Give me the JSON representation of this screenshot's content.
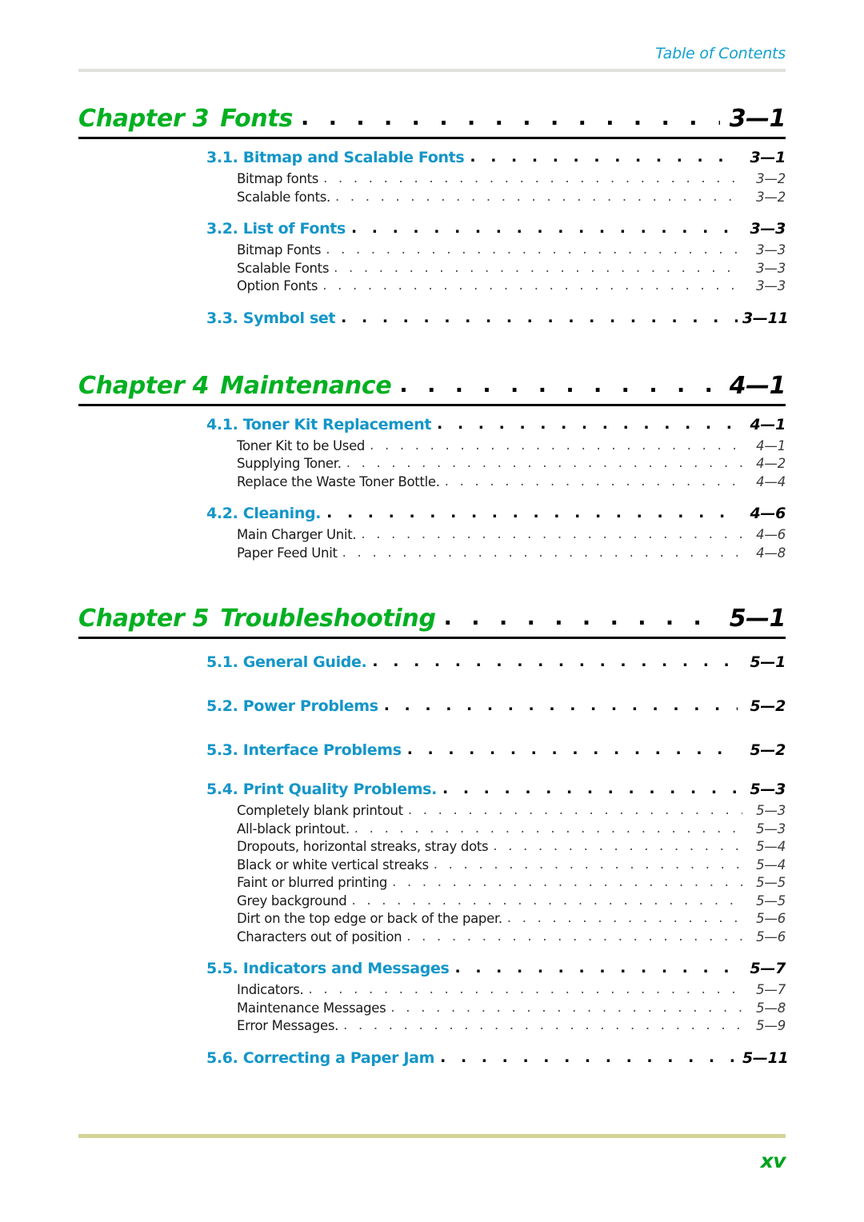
{
  "header": {
    "title": "Table of Contents",
    "rule_color": "#e2e0dc"
  },
  "colors": {
    "chapter_green": "#00b021",
    "section_teal": "#1496c8",
    "subentry_black": "#1a1a1a",
    "footer_rule": "#d4d296",
    "footer_green": "#00a21e"
  },
  "chapters": [
    {
      "label": "Chapter 3",
      "name": "Fonts",
      "page": "3—1",
      "sections": [
        {
          "title": "3.1. Bitmap and Scalable Fonts",
          "page": "3—1",
          "subs": [
            {
              "title": "Bitmap fonts",
              "page": "3—2"
            },
            {
              "title": "Scalable fonts.",
              "page": "3—2"
            }
          ]
        },
        {
          "title": "3.2. List of Fonts",
          "page": "3—3",
          "subs": [
            {
              "title": "Bitmap Fonts",
              "page": "3—3"
            },
            {
              "title": "Scalable Fonts",
              "page": "3—3"
            },
            {
              "title": "Option Fonts",
              "page": "3—3"
            }
          ]
        },
        {
          "title": "3.3. Symbol set",
          "page": "3—11",
          "subs": []
        }
      ]
    },
    {
      "label": "Chapter 4",
      "name": "Maintenance",
      "page": "4—1",
      "sections": [
        {
          "title": "4.1. Toner Kit Replacement",
          "page": "4—1",
          "subs": [
            {
              "title": "Toner Kit to be Used",
              "page": "4—1"
            },
            {
              "title": "Supplying Toner.",
              "page": "4—2"
            },
            {
              "title": "Replace the Waste Toner Bottle.",
              "page": "4—4"
            }
          ]
        },
        {
          "title": "4.2. Cleaning.",
          "page": "4—6",
          "subs": [
            {
              "title": "Main Charger Unit.",
              "page": "4—6"
            },
            {
              "title": "Paper Feed Unit",
              "page": "4—8"
            }
          ]
        }
      ]
    },
    {
      "label": "Chapter 5",
      "name": "Troubleshooting",
      "page": "5—1",
      "sections": [
        {
          "title": "5.1. General Guide.",
          "page": "5—1",
          "subs": []
        },
        {
          "title": "5.2. Power Problems",
          "page": "5—2",
          "subs": []
        },
        {
          "title": "5.3. Interface Problems",
          "page": "5—2",
          "subs": []
        },
        {
          "title": "5.4. Print Quality Problems.",
          "page": "5—3",
          "subs": [
            {
              "title": "Completely blank printout",
              "page": "5—3"
            },
            {
              "title": "All-black printout.",
              "page": "5—3"
            },
            {
              "title": "Dropouts, horizontal streaks, stray dots",
              "page": "5—4"
            },
            {
              "title": "Black or white vertical streaks",
              "page": "5—4"
            },
            {
              "title": "Faint or blurred printing",
              "page": "5—5"
            },
            {
              "title": "Grey background",
              "page": "5—5"
            },
            {
              "title": "Dirt on the top edge or back of the paper.",
              "page": "5—6"
            },
            {
              "title": "Characters out of position",
              "page": "5—6"
            }
          ]
        },
        {
          "title": "5.5. Indicators and Messages",
          "page": "5—7",
          "subs": [
            {
              "title": "Indicators.",
              "page": "5—7"
            },
            {
              "title": "Maintenance Messages",
              "page": "5—8"
            },
            {
              "title": "Error Messages.",
              "page": "5—9"
            }
          ]
        },
        {
          "title": "5.6. Correcting a Paper Jam",
          "page": "5—11",
          "subs": []
        }
      ]
    }
  ],
  "footer": {
    "page_number": "xv"
  },
  "leader": {
    "dots": ". . . . . . . . . . . . . . . . . . . . . . . . . . . . . . . . . . . . . . . . . . . . . . . . . . . . . . . . . . . . . . . . . . . . . . . . . . . . . . . . . . . . . . . . . . . . . . . . . . . . . . . . . . . . . . . . . . . . . . . . . . . . . ."
  }
}
